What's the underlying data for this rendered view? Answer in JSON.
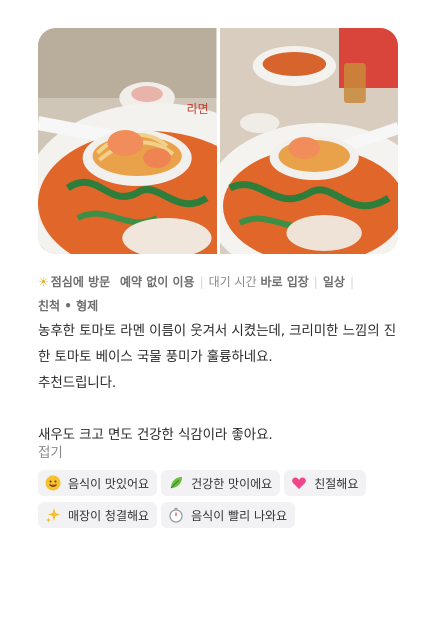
{
  "visit": {
    "when": "점심에 방문",
    "reservation": "예약 없이 이용",
    "wait_label": "대기 시간",
    "wait_value": "바로 입장",
    "purpose": "일상",
    "companion": "친척 • 형제"
  },
  "review": {
    "line1": "농후한 토마토 라멘 이름이 웃겨서 시켰는데, 크리미한 느낌의 진한 토마토 베이스 국물 풍미가 훌륭하네요.",
    "line2": "추천드립니다.",
    "line3": "새우도 크고 면도 건강한 식감이라 좋아요.",
    "fold": "접기"
  },
  "tags": [
    {
      "label": "음식이 맛있어요",
      "icon": "yum-face-icon"
    },
    {
      "label": "건강한 맛이에요",
      "icon": "leaf-icon"
    },
    {
      "label": "친절해요",
      "icon": "heart-icon"
    },
    {
      "label": "매장이 청결해요",
      "icon": "sparkle-icon"
    },
    {
      "label": "음식이 빨리 나와요",
      "icon": "stopwatch-icon"
    }
  ],
  "colors": {
    "accent_sun": "#e7b52c",
    "tag_bg": "#f2f2f4",
    "soup": "#e0662a"
  }
}
